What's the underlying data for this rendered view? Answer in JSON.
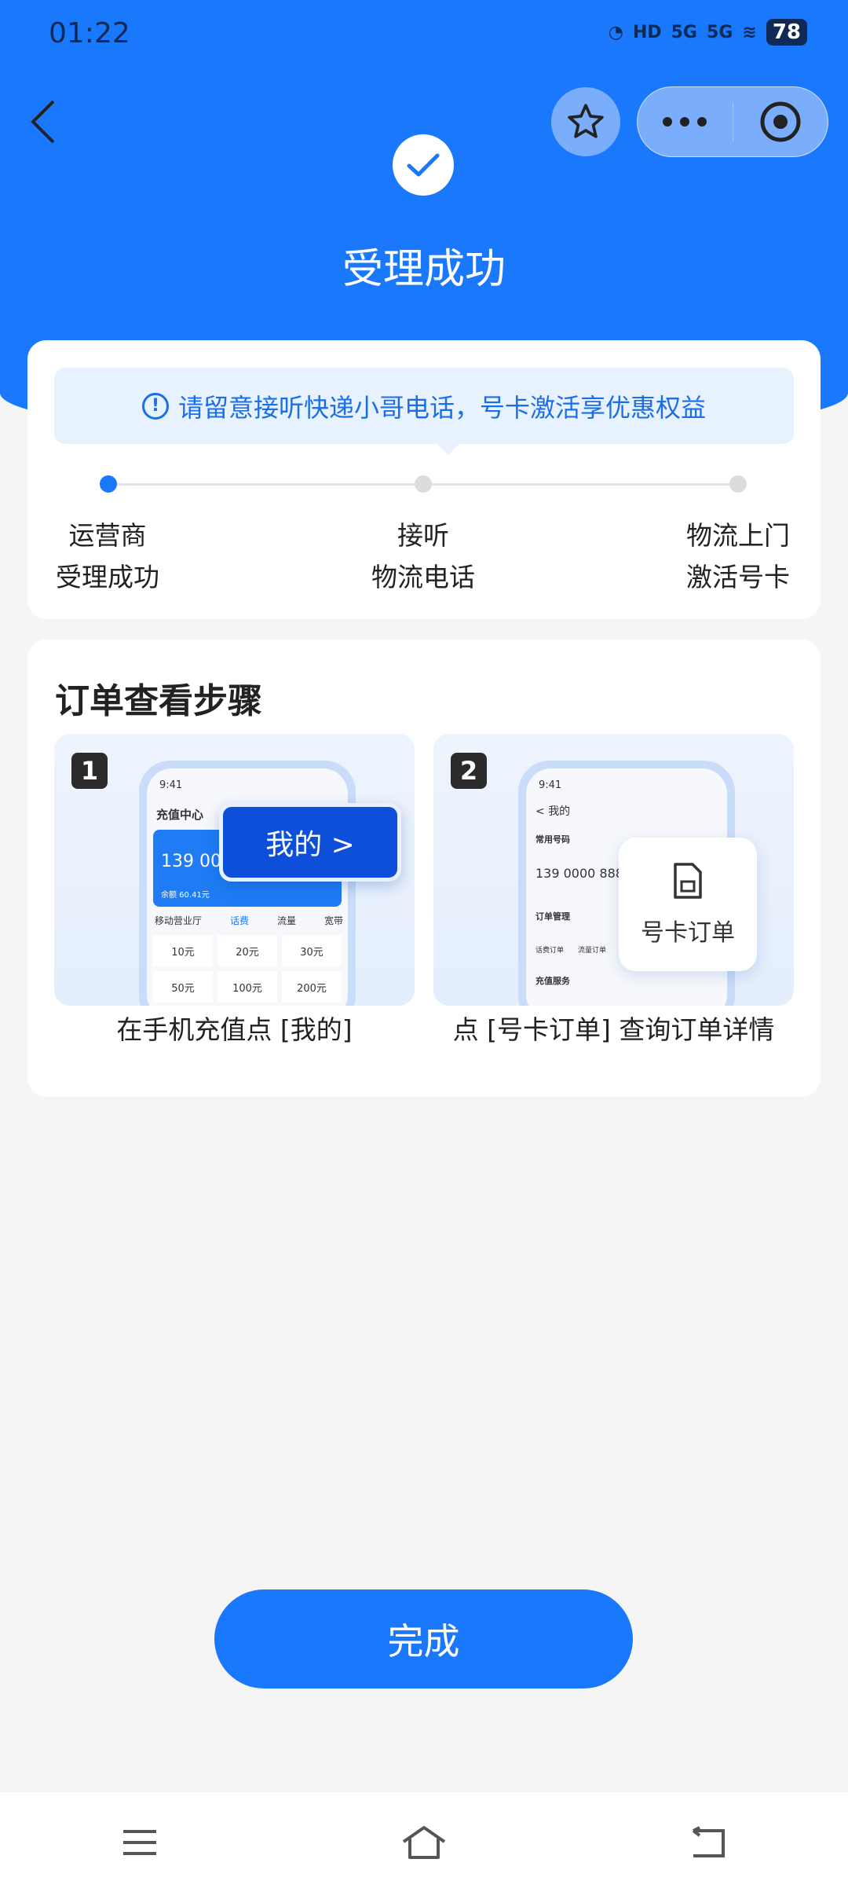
{
  "status_bar": {
    "time": "01:22",
    "network": [
      "HD",
      "5G",
      "5G"
    ],
    "battery": "78"
  },
  "header": {
    "title": "受理成功",
    "icons": [
      "back-icon",
      "star-icon",
      "more-icon",
      "target-icon",
      "check-icon"
    ]
  },
  "progress": {
    "notice": "请留意接听快递小哥电话，号卡激活享优惠权益",
    "steps": [
      {
        "line1": "运营商",
        "line2": "受理成功",
        "active": true
      },
      {
        "line1": "接听",
        "line2": "物流电话",
        "active": false
      },
      {
        "line1": "物流上门",
        "line2": "激活号卡",
        "active": false
      }
    ]
  },
  "guide": {
    "title": "订单查看步骤",
    "steps": [
      {
        "num": "1",
        "caption": "在手机充值点 [我的]",
        "mock": {
          "time": "9:41",
          "title": "充值中心",
          "phone": "139 0000",
          "balance": "余额 60.41元",
          "tabs": [
            "移动营业厅",
            "话费",
            "流量",
            "宽带"
          ],
          "amounts": [
            "10元",
            "20元",
            "30元",
            "50元",
            "100元",
            "200元"
          ],
          "callout": "我的 >"
        }
      },
      {
        "num": "2",
        "caption": "点 [号卡订单] 查询订单详情",
        "mock": {
          "time": "9:41",
          "title": "我的",
          "section1": "常用号码",
          "phone": "139 0000 8888",
          "section2": "订单管理",
          "orders": [
            "话费订单",
            "流量订单"
          ],
          "section3": "充值服务",
          "callout": "号卡订单"
        }
      }
    ]
  },
  "done_button": "完成",
  "colors": {
    "primary": "#1a78fc",
    "notice_bg": "#e8f1fe",
    "background": "#f5f5f5"
  }
}
